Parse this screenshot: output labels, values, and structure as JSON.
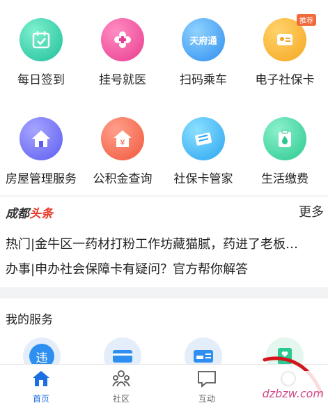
{
  "services_grid": [
    {
      "label": "每日签到",
      "icon": "calendar-check-icon"
    },
    {
      "label": "挂号就医",
      "icon": "medical-flower-icon"
    },
    {
      "label": "扫码乘车",
      "icon": "tianfutong-card-icon",
      "glyph": "天府通"
    },
    {
      "label": "电子社保卡",
      "icon": "id-card-icon",
      "badge": "推荐"
    },
    {
      "label": "房屋管理服务",
      "icon": "house-icon"
    },
    {
      "label": "公积金查询",
      "icon": "yuan-house-icon"
    },
    {
      "label": "社保卡管家",
      "icon": "card-icon"
    },
    {
      "label": "生活缴费",
      "icon": "clipboard-drop-icon"
    }
  ],
  "news": {
    "logo_a": "成都",
    "logo_b": "头条",
    "more": "更多",
    "items": [
      "热门|金牛区一药材打粉工作坊藏猫腻，药进了老板…",
      "办事|申办社会保障卡有疑问？官方帮你解答"
    ]
  },
  "my_services": {
    "title": "我的服务",
    "first_icon_glyph": "违"
  },
  "tabbar": [
    {
      "label": "首页",
      "icon": "home-icon",
      "active": true
    },
    {
      "label": "社区",
      "icon": "community-icon",
      "active": false
    },
    {
      "label": "互动",
      "icon": "chat-icon",
      "active": false
    },
    {
      "label": "",
      "icon": "profile-icon",
      "active": false
    }
  ],
  "watermark": "dzbzw.com",
  "colors": {
    "accent": "#1d6fe0",
    "news_red": "#e83a2a",
    "badge": "#f06a3a"
  }
}
